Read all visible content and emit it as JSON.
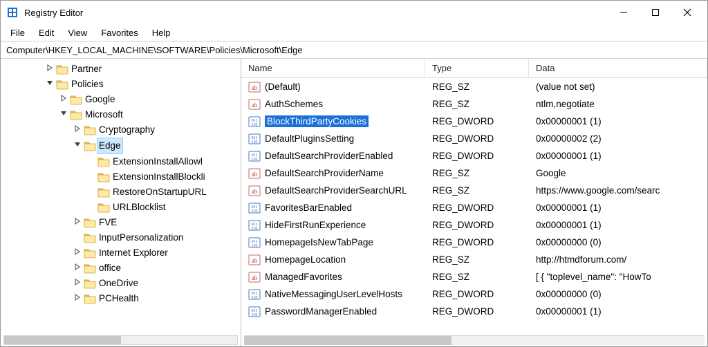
{
  "window": {
    "title": "Registry Editor"
  },
  "menu": {
    "file": "File",
    "edit": "Edit",
    "view": "View",
    "favorites": "Favorites",
    "help": "Help"
  },
  "address": "Computer\\HKEY_LOCAL_MACHINE\\SOFTWARE\\Policies\\Microsoft\\Edge",
  "tree": {
    "items": [
      {
        "depth": 3,
        "toggle": ">",
        "label": "Partner"
      },
      {
        "depth": 3,
        "toggle": "v",
        "label": "Policies"
      },
      {
        "depth": 4,
        "toggle": ">",
        "label": "Google"
      },
      {
        "depth": 4,
        "toggle": "v",
        "label": "Microsoft"
      },
      {
        "depth": 5,
        "toggle": ">",
        "label": "Cryptography"
      },
      {
        "depth": 5,
        "toggle": "v",
        "label": "Edge",
        "selected": true
      },
      {
        "depth": 6,
        "toggle": "",
        "label": "ExtensionInstallAllowl"
      },
      {
        "depth": 6,
        "toggle": "",
        "label": "ExtensionInstallBlockli"
      },
      {
        "depth": 6,
        "toggle": "",
        "label": "RestoreOnStartupURL"
      },
      {
        "depth": 6,
        "toggle": "",
        "label": "URLBlocklist"
      },
      {
        "depth": 5,
        "toggle": ">",
        "label": "FVE"
      },
      {
        "depth": 5,
        "toggle": "",
        "label": "InputPersonalization"
      },
      {
        "depth": 5,
        "toggle": ">",
        "label": "Internet Explorer"
      },
      {
        "depth": 5,
        "toggle": ">",
        "label": "office"
      },
      {
        "depth": 5,
        "toggle": ">",
        "label": "OneDrive"
      },
      {
        "depth": 5,
        "toggle": ">",
        "label": "PCHealth"
      }
    ]
  },
  "list": {
    "columns": {
      "name": "Name",
      "type": "Type",
      "data": "Data"
    },
    "rows": [
      {
        "icon": "sz",
        "name": "(Default)",
        "type": "REG_SZ",
        "data": "(value not set)"
      },
      {
        "icon": "sz",
        "name": "AuthSchemes",
        "type": "REG_SZ",
        "data": "ntlm,negotiate"
      },
      {
        "icon": "bin",
        "name": "BlockThirdPartyCookies",
        "type": "REG_DWORD",
        "data": "0x00000001 (1)",
        "selected": true
      },
      {
        "icon": "bin",
        "name": "DefaultPluginsSetting",
        "type": "REG_DWORD",
        "data": "0x00000002 (2)"
      },
      {
        "icon": "bin",
        "name": "DefaultSearchProviderEnabled",
        "type": "REG_DWORD",
        "data": "0x00000001 (1)"
      },
      {
        "icon": "sz",
        "name": "DefaultSearchProviderName",
        "type": "REG_SZ",
        "data": "Google"
      },
      {
        "icon": "sz",
        "name": "DefaultSearchProviderSearchURL",
        "type": "REG_SZ",
        "data": "https://www.google.com/searc"
      },
      {
        "icon": "bin",
        "name": "FavoritesBarEnabled",
        "type": "REG_DWORD",
        "data": "0x00000001 (1)"
      },
      {
        "icon": "bin",
        "name": "HideFirstRunExperience",
        "type": "REG_DWORD",
        "data": "0x00000001 (1)"
      },
      {
        "icon": "bin",
        "name": "HomepageIsNewTabPage",
        "type": "REG_DWORD",
        "data": "0x00000000 (0)"
      },
      {
        "icon": "sz",
        "name": "HomepageLocation",
        "type": "REG_SZ",
        "data": "http://htmdforum.com/"
      },
      {
        "icon": "sz",
        "name": "ManagedFavorites",
        "type": "REG_SZ",
        "data": "[ {   \"toplevel_name\": \"HowTo"
      },
      {
        "icon": "bin",
        "name": "NativeMessagingUserLevelHosts",
        "type": "REG_DWORD",
        "data": "0x00000000 (0)"
      },
      {
        "icon": "bin",
        "name": "PasswordManagerEnabled",
        "type": "REG_DWORD",
        "data": "0x00000001 (1)"
      }
    ]
  }
}
